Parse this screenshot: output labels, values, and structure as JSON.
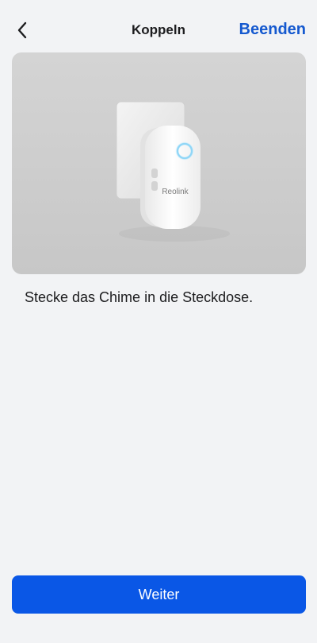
{
  "nav": {
    "back_icon": "chevron-left-icon",
    "title": "Koppeln",
    "done_label": "Beenden"
  },
  "hero": {
    "brand_text": "Reolink"
  },
  "content": {
    "instruction": "Stecke das Chime in die Steckdose."
  },
  "footer": {
    "next_label": "Weiter"
  },
  "colors": {
    "background": "#f2f3f5",
    "accent": "#1559cf",
    "button": "#0a57e6"
  }
}
